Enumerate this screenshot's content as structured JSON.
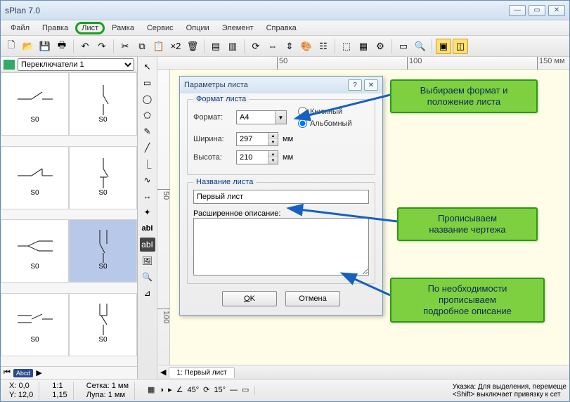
{
  "window": {
    "title": "sPlan 7.0"
  },
  "menu": {
    "items": [
      "Файл",
      "Правка",
      "Лист",
      "Рамка",
      "Сервис",
      "Опции",
      "Элемент",
      "Справка"
    ],
    "highlight_index": 2
  },
  "toolbar": {
    "x2": "×2"
  },
  "library": {
    "selector": "Переключатели 1",
    "cells": [
      {
        "label": "S0"
      },
      {
        "label": "S0"
      },
      {
        "label": "S0"
      },
      {
        "label": "S0"
      },
      {
        "label": "S0"
      },
      {
        "label": "S0",
        "selected": true
      },
      {
        "label": "S0"
      },
      {
        "label": "S0"
      }
    ],
    "foot_chip": "Abcd"
  },
  "ruler": {
    "h": [
      "50",
      "100",
      "150 мм"
    ],
    "v": [
      "50",
      "100"
    ]
  },
  "tab": {
    "label": "1: Первый лист"
  },
  "dialog": {
    "title": "Параметры листа",
    "group_format": "Формат листа",
    "format_label": "Формат:",
    "format_value": "A4",
    "orient_portrait": "Книжный",
    "orient_landscape": "Альбомный",
    "orient_selected": "landscape",
    "width_label": "Ширина:",
    "width_value": "297",
    "height_label": "Высота:",
    "height_value": "210",
    "unit": "мм",
    "group_name": "Название листа",
    "name_value": "Первый лист",
    "desc_label": "Расширенное описание:",
    "ok": "OK",
    "cancel": "Отмена"
  },
  "callouts": {
    "c1": "Выбираем формат и\nположение листа",
    "c2": "Прописываем\nназвание чертежа",
    "c3": "По необходимости\nпрописываем\nподробное описание"
  },
  "status": {
    "xy": "X: 0,0\nY: 12,0",
    "scale": "1:1\n1,15",
    "grid": "Сетка: 1 мм\nЛупа: 1 мм",
    "angle1": "45°",
    "angle2": "15°",
    "hint": "Указка: Для выделения, перемеще\n<Shift> выключает привязку к сет"
  }
}
